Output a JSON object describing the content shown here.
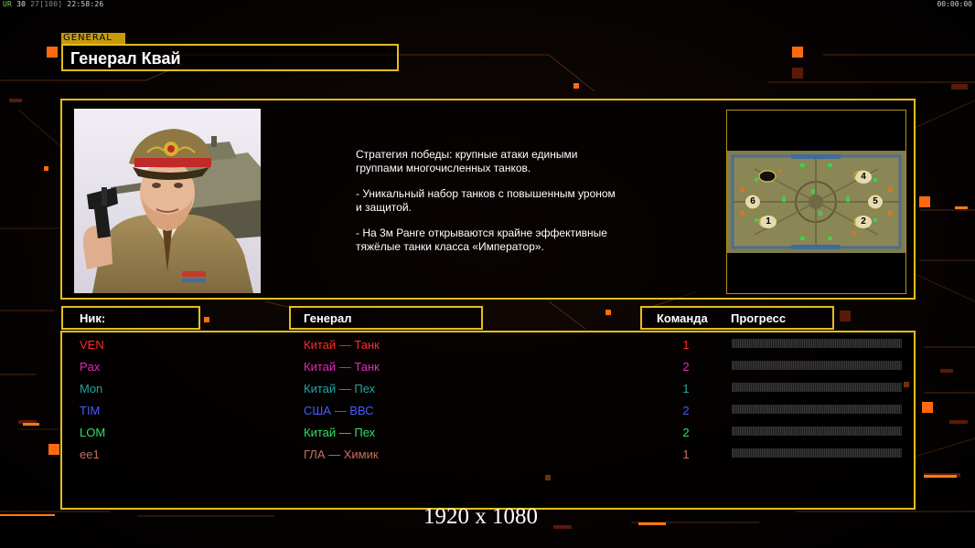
{
  "hud": {
    "ur_label": "UR",
    "fps": "30",
    "fps_separator": " ",
    "fps_max": "27[100]",
    "clock": "22:58:26",
    "timer": "00:00:00"
  },
  "general": {
    "tag": "GENERAL",
    "name": "Генерал Квай",
    "description": [
      "Стратегия победы: крупные атаки едиными\n группами многочисленных танков.",
      "- Уникальный набор танков с повышенным уроном\n и защитой.",
      "- На 3м Ранге открываются крайне эффективные\n тяжёлые танки класса «Император»."
    ]
  },
  "minimap": {
    "start_labels": [
      "4",
      "6",
      "5",
      "1",
      "2"
    ]
  },
  "table": {
    "headers": {
      "nick": "Ник:",
      "general": "Генерал",
      "team": "Команда",
      "progress": "Прогресс"
    },
    "rows": [
      {
        "nick": "VEN",
        "general": "Китай — Танк",
        "team": "1",
        "color": "#ff2a2a",
        "progress": 0
      },
      {
        "nick": "Pax",
        "general": "Китай — Танк",
        "team": "2",
        "color": "#e02bb8",
        "progress": 0
      },
      {
        "nick": "Mon",
        "general": "Китай — Пех",
        "team": "1",
        "color": "#1fa6a6",
        "progress": 0
      },
      {
        "nick": "TIM",
        "general": "США — ВВС",
        "team": "2",
        "color": "#4a5dff",
        "progress": 0
      },
      {
        "nick": "LOM",
        "general": "Китай — Пех",
        "team": "2",
        "color": "#2fe06a",
        "progress": 0
      },
      {
        "nick": "ee1",
        "general": "ГЛА — Химик",
        "team": "1",
        "color": "#c8705e",
        "progress": 0
      }
    ]
  },
  "resolution": "1920 x 1080",
  "colors": {
    "frame": "#e4bd1c",
    "accent_orange": "#ff7a12"
  }
}
